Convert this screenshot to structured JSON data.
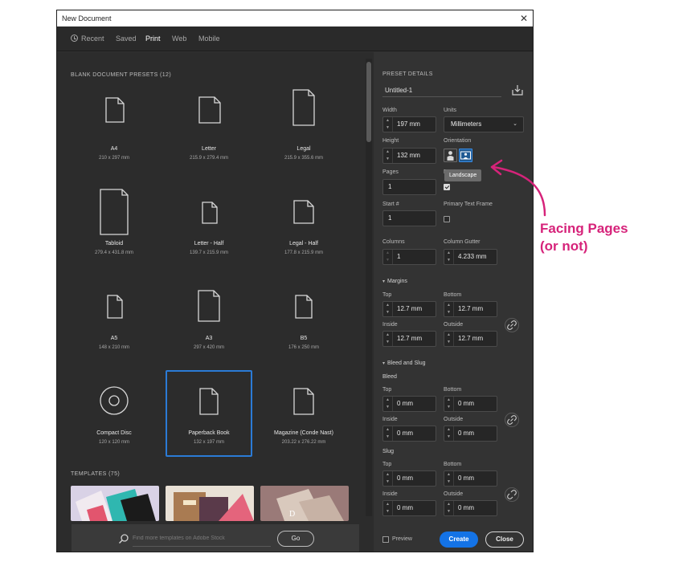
{
  "window": {
    "title": "New Document",
    "close_glyph": "✕"
  },
  "tabs": [
    {
      "label": "Recent",
      "icon": "clock-icon",
      "active": false
    },
    {
      "label": "Saved",
      "active": false
    },
    {
      "label": "Print",
      "active": true
    },
    {
      "label": "Web",
      "active": false
    },
    {
      "label": "Mobile",
      "active": false
    }
  ],
  "presets": {
    "title": "BLANK DOCUMENT PRESETS",
    "count": "(12)",
    "items": [
      {
        "name": "A4",
        "size": "210 x 297 mm"
      },
      {
        "name": "Letter",
        "size": "215.9 x 279.4 mm"
      },
      {
        "name": "Legal",
        "size": "215.9 x 355.6 mm"
      },
      {
        "name": "Tabloid",
        "size": "279.4 x 431.8 mm"
      },
      {
        "name": "Letter - Half",
        "size": "139.7 x 215.9 mm"
      },
      {
        "name": "Legal - Half",
        "size": "177.8 x 215.9 mm"
      },
      {
        "name": "A5",
        "size": "148 x 210 mm"
      },
      {
        "name": "A3",
        "size": "297 x 420 mm"
      },
      {
        "name": "B5",
        "size": "176 x 250 mm"
      },
      {
        "name": "Compact Disc",
        "size": "120 x 120 mm"
      },
      {
        "name": "Paperback Book",
        "size": "132 x 197 mm",
        "selected": true
      },
      {
        "name": "Magazine (Conde Nast)",
        "size": "203.22 x 276.22 mm"
      }
    ]
  },
  "templates": {
    "title": "TEMPLATES",
    "count": "(75)"
  },
  "search": {
    "placeholder": "Find more templates on Adobe Stock",
    "go_label": "Go"
  },
  "details": {
    "header": "PRESET DETAILS",
    "name": "Untitled-1",
    "width_label": "Width",
    "width": "197 mm",
    "units_label": "Units",
    "units": "Millimeters",
    "height_label": "Height",
    "height": "132 mm",
    "orientation_label": "Orientation",
    "pages_label": "Pages",
    "pages": "1",
    "facing_label": "F",
    "tooltip": "Landscape",
    "facing_checked": true,
    "start_label": "Start #",
    "start": "1",
    "primary_frame_label": "Primary Text Frame",
    "columns_label": "Columns",
    "columns": "1",
    "gutter_label": "Column Gutter",
    "gutter": "4.233 mm",
    "margins_label": "Margins",
    "top_label": "Top",
    "bottom_label": "Bottom",
    "inside_label": "Inside",
    "outside_label": "Outside",
    "margin_top": "12.7 mm",
    "margin_bottom": "12.7 mm",
    "margin_inside": "12.7 mm",
    "margin_outside": "12.7 mm",
    "bleed_slug_label": "Bleed and Slug",
    "bleed_label": "Bleed",
    "bleed_top": "0 mm",
    "bleed_bottom": "0 mm",
    "bleed_inside": "0 mm",
    "bleed_outside": "0 mm",
    "slug_label": "Slug",
    "slug_top": "0 mm",
    "slug_bottom": "0 mm",
    "slug_inside": "0 mm",
    "slug_outside": "0 mm",
    "preview_label": "Preview",
    "create_label": "Create",
    "close_label": "Close"
  },
  "annotation": {
    "line1": "Facing Pages",
    "line2": "(or not)",
    "color": "#d6237a"
  },
  "colors": {
    "accent": "#1473e6",
    "selection": "#2b7bd6",
    "dialog_bg": "#323232"
  }
}
